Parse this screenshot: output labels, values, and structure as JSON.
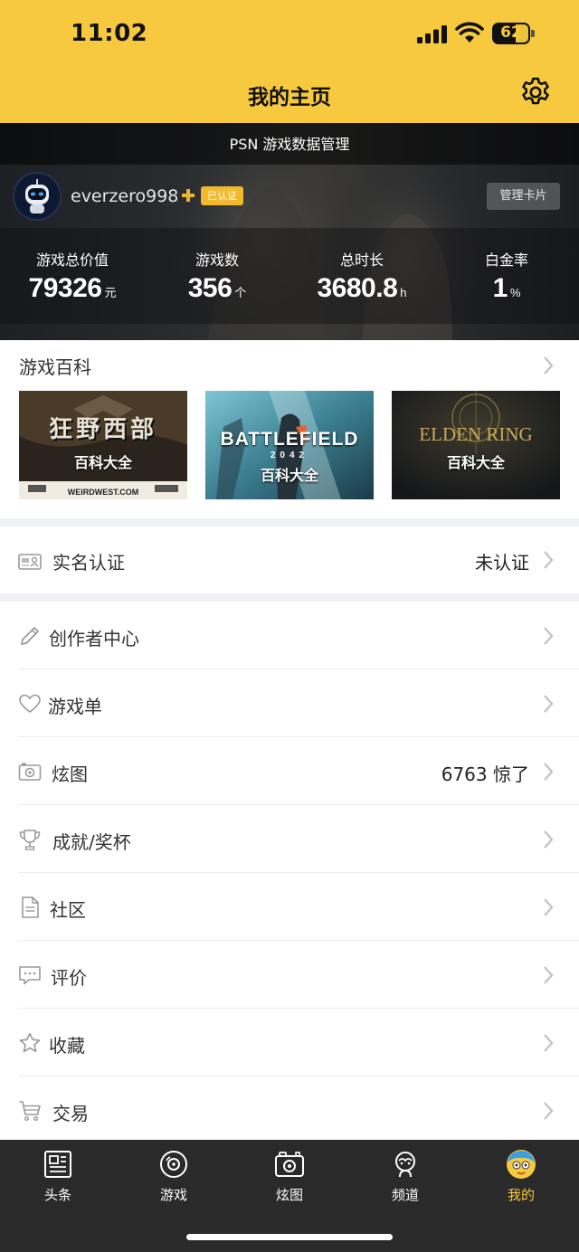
{
  "status_bar": {
    "time": "11:02",
    "battery": "62"
  },
  "header": {
    "title": "我的主页",
    "settings_icon": "gear-icon"
  },
  "psn_card": {
    "banner": "PSN 游戏数据管理",
    "username": "everzero998",
    "badge": "已认证",
    "manage_button": "管理卡片",
    "stats": [
      {
        "label": "游戏总价值",
        "value": "79326",
        "unit": "元"
      },
      {
        "label": "游戏数",
        "value": "356",
        "unit": "个"
      },
      {
        "label": "总时长",
        "value": "3680.8",
        "unit": "h"
      },
      {
        "label": "白金率",
        "value": "1",
        "unit": "%"
      }
    ]
  },
  "wiki": {
    "title": "游戏百科",
    "cards": [
      {
        "game": "狂野西部",
        "subtitle": "百科大全",
        "brand": "WEIRDWEST.COM"
      },
      {
        "game": "BATTLEFIELD",
        "game_sub": "2042",
        "subtitle": "百科大全"
      },
      {
        "game": "ELDEN RING",
        "subtitle": "百科大全"
      }
    ]
  },
  "realname": {
    "label": "实名认证",
    "value": "未认证",
    "icon": "id-card-icon"
  },
  "menu": [
    {
      "label": "创作者中心",
      "value": "",
      "icon": "pencil-icon"
    },
    {
      "label": "游戏单",
      "value": "",
      "icon": "heart-icon"
    },
    {
      "label": "炫图",
      "value": "6763 惊了",
      "icon": "camera-icon"
    },
    {
      "label": "成就/奖杯",
      "value": "",
      "icon": "trophy-icon"
    },
    {
      "label": "社区",
      "value": "",
      "icon": "document-icon"
    },
    {
      "label": "评价",
      "value": "",
      "icon": "comment-icon"
    },
    {
      "label": "收藏",
      "value": "",
      "icon": "star-icon"
    },
    {
      "label": "交易",
      "value": "",
      "icon": "cart-icon"
    }
  ],
  "tabs": [
    {
      "label": "头条",
      "icon": "newspaper-icon",
      "active": false
    },
    {
      "label": "游戏",
      "icon": "disc-icon",
      "active": false
    },
    {
      "label": "炫图",
      "icon": "camera-icon",
      "active": false
    },
    {
      "label": "频道",
      "icon": "channel-icon",
      "active": false
    },
    {
      "label": "我的",
      "icon": "profile-avatar-icon",
      "active": true
    }
  ],
  "colors": {
    "accent": "#f7c93e",
    "tabbar": "#2a2a2a",
    "badge": "#f2b92f"
  }
}
